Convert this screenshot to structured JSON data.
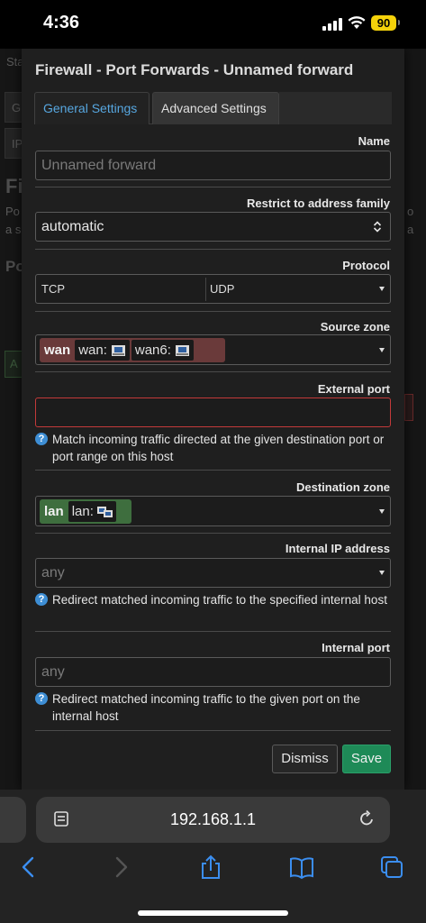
{
  "status": {
    "time": "4:36",
    "battery": "90"
  },
  "background": {
    "frag1": "Sta",
    "frag2": "G",
    "frag3": "IP",
    "title": "Fi",
    "line1": "Po",
    "line2": "a s",
    "right1": "o",
    "right2": "a",
    "section": "Po",
    "small": "A"
  },
  "modal": {
    "title": "Firewall - Port Forwards - Unnamed forward",
    "tabs": {
      "general": "General Settings",
      "advanced": "Advanced Settings"
    },
    "name": {
      "label": "Name",
      "placeholder": "Unnamed forward"
    },
    "family": {
      "label": "Restrict to address family",
      "value": "automatic"
    },
    "protocol": {
      "label": "Protocol",
      "values": [
        "TCP",
        "UDP"
      ]
    },
    "source_zone": {
      "label": "Source zone",
      "zone": "wan",
      "devices": [
        "wan:",
        "wan6:"
      ]
    },
    "external_port": {
      "label": "External port",
      "value": "",
      "hint": "Match incoming traffic directed at the given destination port or port range on this host"
    },
    "dest_zone": {
      "label": "Destination zone",
      "zone": "lan",
      "devices": [
        "lan:"
      ]
    },
    "internal_ip": {
      "label": "Internal IP address",
      "placeholder": "any",
      "hint": "Redirect matched incoming traffic to the specified internal host"
    },
    "internal_port": {
      "label": "Internal port",
      "placeholder": "any",
      "hint": "Redirect matched incoming traffic to the given port on the internal host"
    },
    "buttons": {
      "dismiss": "Dismiss",
      "save": "Save"
    }
  },
  "browser": {
    "url": "192.168.1.1"
  },
  "colors": {
    "accent": "#57a7e0",
    "save": "#1e8a57",
    "wan": "#6a3a3a",
    "lan": "#3e6e3e",
    "error": "#c33a3a"
  },
  "icons": {
    "reader": "reader-icon",
    "reload": "reload-icon",
    "back": "back-icon",
    "forward": "forward-icon",
    "share": "share-icon",
    "bookmarks": "bookmarks-icon",
    "tabs": "tabs-icon"
  }
}
